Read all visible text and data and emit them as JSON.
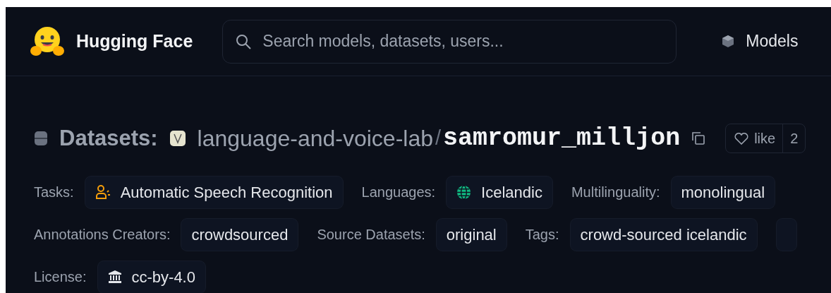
{
  "brand": {
    "name": "Hugging Face"
  },
  "search": {
    "placeholder": "Search models, datasets, users..."
  },
  "nav": [
    {
      "label": "Models",
      "kind": "cube"
    }
  ],
  "title": {
    "section": "Datasets:",
    "owner": "language-and-voice-lab",
    "separator": "/",
    "name": "samromur_milljon"
  },
  "like": {
    "label": "like",
    "count": "2"
  },
  "tag_rows": [
    [
      {
        "label": "Tasks:",
        "chips": [
          {
            "text": "Automatic Speech Recognition",
            "kind": "speech"
          }
        ]
      },
      {
        "label": "Languages:",
        "chips": [
          {
            "text": "Icelandic",
            "kind": "globe"
          }
        ]
      },
      {
        "label": "Multilinguality:",
        "chips": [
          {
            "text": "monolingual"
          }
        ]
      }
    ],
    [
      {
        "label": "Annotations Creators:",
        "chips": [
          {
            "text": "crowdsourced"
          }
        ]
      },
      {
        "label": "Source Datasets:",
        "chips": [
          {
            "text": "original"
          }
        ]
      },
      {
        "label": "Tags:",
        "chips": [
          {
            "text": "crowd-sourced icelandic"
          },
          {
            "kind": "cut"
          }
        ]
      }
    ],
    [
      {
        "label": "License:",
        "chips": [
          {
            "text": "cc-by-4.0",
            "kind": "bank"
          }
        ]
      }
    ]
  ]
}
